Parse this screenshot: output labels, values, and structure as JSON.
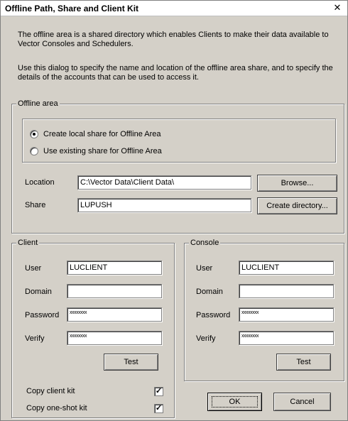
{
  "window": {
    "title": "Offline Path, Share and Client Kit",
    "close_glyph": "✕"
  },
  "intro": {
    "para1": "The offline area is a shared directory which enables Clients to make their data available to Vector Consoles and Schedulers.",
    "para2": "Use this dialog to specify the name and location of the offline area share, and to specify the details of the accounts that can be used to access it."
  },
  "offline_area": {
    "legend": "Offline area",
    "radio_create": {
      "label": "Create local share for Offline Area",
      "checked": true
    },
    "radio_existing": {
      "label": "Use existing share for Offline Area",
      "checked": false
    },
    "location_label": "Location",
    "location_value": "C:\\Vector Data\\Client Data\\",
    "share_label": "Share",
    "share_value": "LUPUSH",
    "browse_label": "Browse...",
    "create_dir_label": "Create directory..."
  },
  "client": {
    "legend": "Client",
    "user_label": "User",
    "user_value": "LUCLIENT",
    "domain_label": "Domain",
    "domain_value": "",
    "password_label": "Password",
    "password_value": "xxxxxxxx",
    "verify_label": "Verify",
    "verify_value": "xxxxxxxx",
    "test_label": "Test",
    "copy_client_kit_label": "Copy client kit",
    "copy_client_kit_checked": true,
    "copy_oneshot_kit_label": "Copy one-shot kit",
    "copy_oneshot_kit_checked": true,
    "check_glyph": "✓"
  },
  "console": {
    "legend": "Console",
    "user_label": "User",
    "user_value": "LUCLIENT",
    "domain_label": "Domain",
    "domain_value": "",
    "password_label": "Password",
    "password_value": "xxxxxxxx",
    "verify_label": "Verify",
    "verify_value": "xxxxxxxx",
    "test_label": "Test"
  },
  "footer": {
    "ok_label": "OK",
    "cancel_label": "Cancel"
  }
}
